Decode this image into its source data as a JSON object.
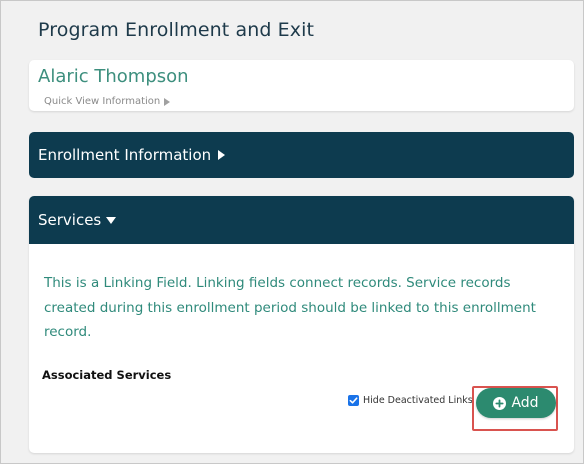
{
  "page": {
    "title": "Program Enrollment and Exit"
  },
  "client": {
    "name": "Alaric Thompson",
    "quick_view": "Quick View Information"
  },
  "sections": {
    "enrollment": {
      "label": "Enrollment Information"
    },
    "services": {
      "label": "Services",
      "linking_text": "This is a Linking Field. Linking fields connect records. Service records created during this enrollment period should be linked to this enrollment record.",
      "associated_label": "Associated Services",
      "hide_deactivated_label": "Hide Deactivated Links",
      "hide_deactivated_checked": true,
      "add_button_label": "Add"
    }
  },
  "colors": {
    "header_bar": "#0d3b4f",
    "accent_text": "#3d8f7e",
    "add_button": "#2c8a6f",
    "highlight": "#d9534f"
  }
}
